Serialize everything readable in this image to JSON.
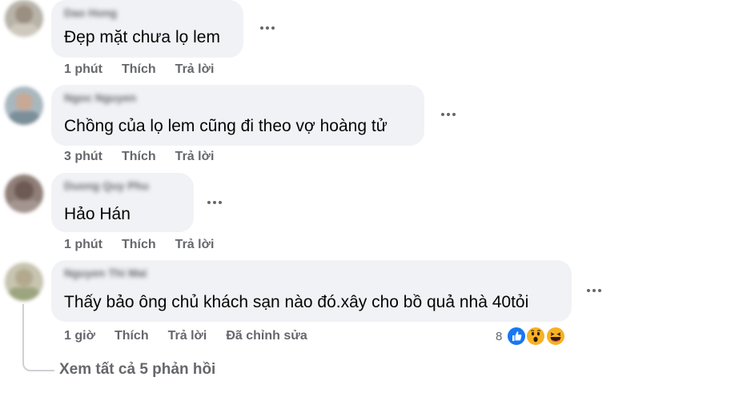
{
  "comments": [
    {
      "author": "Dao Hong",
      "text": "Đẹp mặt chưa lọ lem",
      "time": "1 phút",
      "like_label": "Thích",
      "reply_label": "Trả lời"
    },
    {
      "author": "Ngoc Nguyen",
      "text": "Chồng của lọ lem cũng đi theo vợ hoàng tử",
      "time": "3 phút",
      "like_label": "Thích",
      "reply_label": "Trả lời"
    },
    {
      "author": "Duong Quy Phu",
      "text": "Hảo Hán",
      "time": "1 phút",
      "like_label": "Thích",
      "reply_label": "Trả lời"
    },
    {
      "author": "Nguyen Thi Mai",
      "text": "Thấy bảo ông chủ khách sạn nào đó.xây cho bồ quả nhà 40tỏi",
      "time": "1 giờ",
      "like_label": "Thích",
      "reply_label": "Trả lời",
      "edited_label": "Đã chỉnh sửa",
      "reaction_count": "8"
    }
  ],
  "view_replies": "Xem tất cả 5 phản hồi",
  "icons": {
    "more": "more-options-icon",
    "like": "like-reaction-icon",
    "wow": "wow-reaction-icon",
    "haha": "haha-reaction-icon"
  },
  "colors": {
    "bubble": "#f0f2f5",
    "secondary_text": "#65676b",
    "like_blue": "#1877f2",
    "emoji_yellow": "#f7b125"
  }
}
